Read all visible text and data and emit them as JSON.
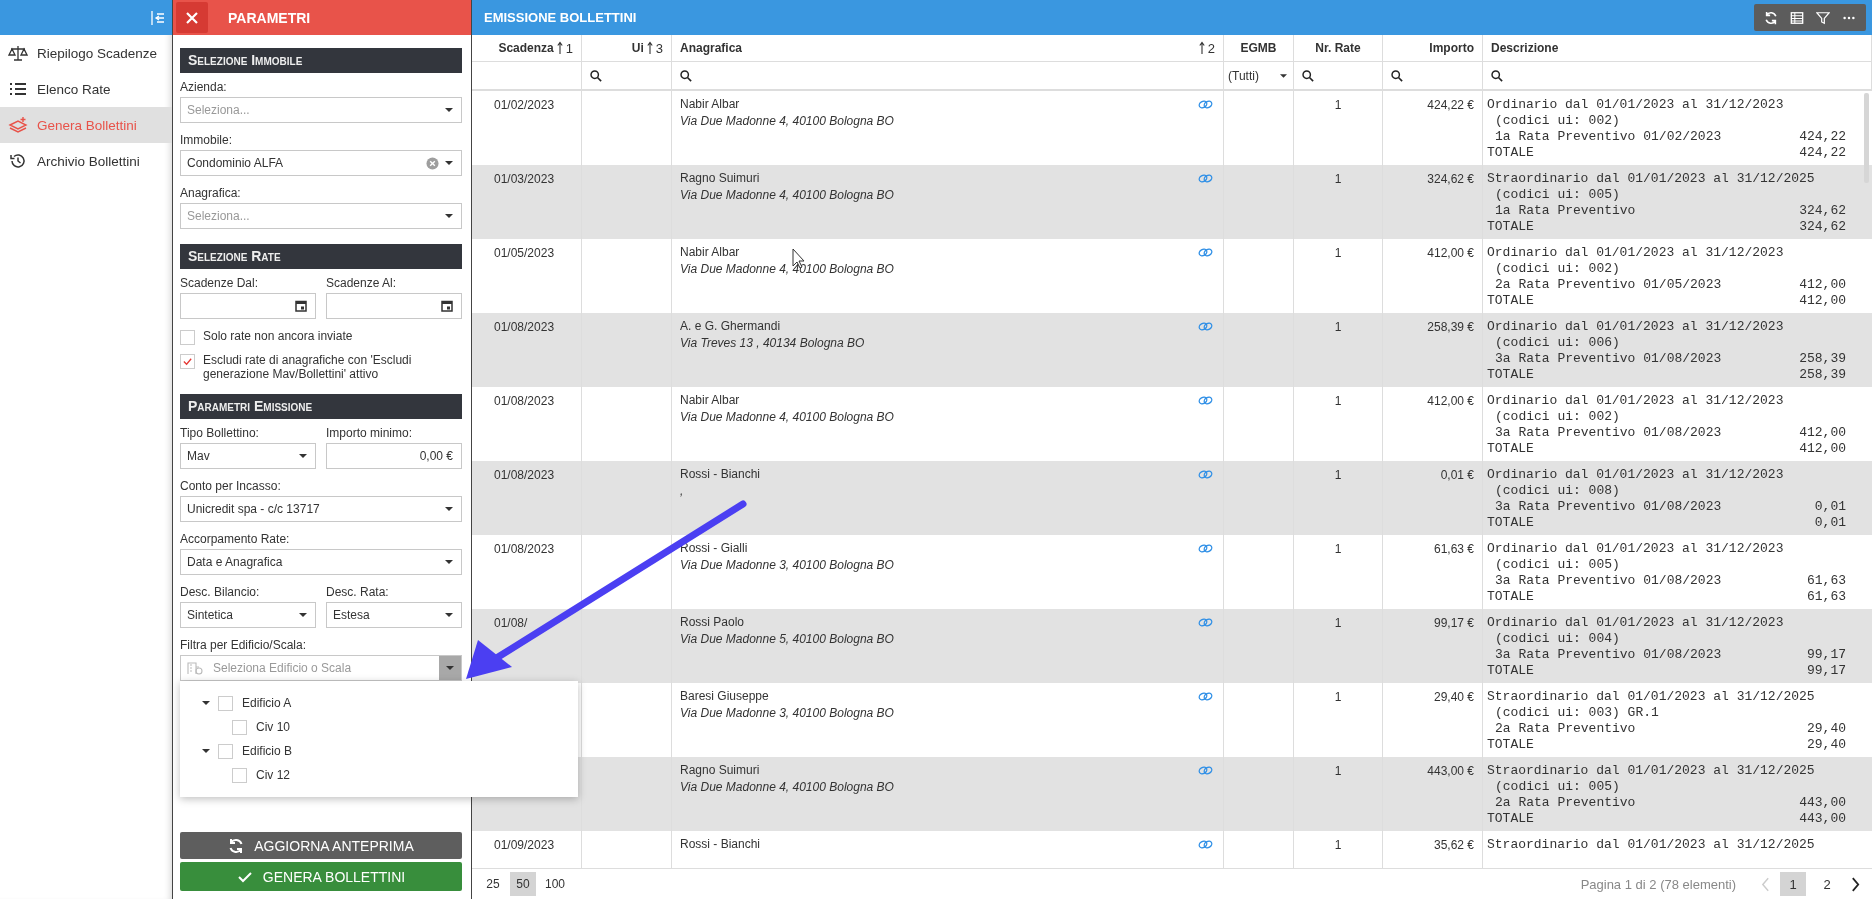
{
  "sidebar": {
    "items": [
      {
        "label": "Riepilogo Scadenze",
        "selected": false
      },
      {
        "label": "Elenco Rate",
        "selected": false
      },
      {
        "label": "Genera Bollettini",
        "selected": true
      },
      {
        "label": "Archivio Bollettini",
        "selected": false
      }
    ]
  },
  "params": {
    "title": "PARAMETRI",
    "sections": [
      {
        "title": "Selezione Immobile",
        "rows": [
          [
            {
              "kind": "select",
              "label": "Azienda:",
              "placeholder": "Seleziona..."
            }
          ],
          [
            {
              "kind": "select",
              "label": "Immobile:",
              "value": "Condominio ALFA",
              "clearable": true
            }
          ],
          [
            {
              "kind": "select",
              "label": "Anagrafica:",
              "placeholder": "Seleziona..."
            }
          ]
        ]
      },
      {
        "title": "Selezione Rate",
        "rows": [
          [
            {
              "kind": "date",
              "label": "Scadenze Dal:"
            },
            {
              "kind": "date",
              "label": "Scadenze Al:"
            }
          ],
          [
            {
              "kind": "checkbox",
              "label": "Solo rate non ancora inviate",
              "checked": false
            }
          ],
          [
            {
              "kind": "checkbox",
              "label": "Escludi rate di anagrafiche con 'Escludi generazione Mav/Bollettini' attivo",
              "checked": true
            }
          ]
        ]
      },
      {
        "title": "Parametri Emissione",
        "rows": [
          [
            {
              "kind": "select",
              "label": "Tipo Bollettino:",
              "value": "Mav"
            },
            {
              "kind": "input",
              "label": "Importo minimo:",
              "value": "0,00 €"
            }
          ],
          [
            {
              "kind": "select",
              "label": "Conto per Incasso:",
              "value": "Unicredit spa - c/c 13717"
            }
          ],
          [
            {
              "kind": "select",
              "label": "Accorpamento Rate:",
              "value": "Data e Anagrafica"
            }
          ],
          [
            {
              "kind": "select",
              "label": "Desc. Bilancio:",
              "value": "Sintetica"
            },
            {
              "kind": "select",
              "label": "Desc. Rata:",
              "value": "Estesa"
            }
          ],
          [
            {
              "kind": "tree",
              "label": "Filtra per Edificio/Scala:",
              "placeholder": "Seleziona Edificio o Scala",
              "expanded": true,
              "options": [
                {
                  "label": "Edificio A",
                  "checked": false,
                  "expanded": true,
                  "children": [
                    {
                      "label": "Civ 10",
                      "checked": false
                    }
                  ]
                },
                {
                  "label": "Edificio B",
                  "checked": false,
                  "expanded": true,
                  "children": [
                    {
                      "label": "Civ 12",
                      "checked": false
                    }
                  ]
                }
              ]
            }
          ]
        ]
      }
    ],
    "buttons": [
      {
        "label": "AGGIORNA ANTEPRIMA",
        "kind": "refresh"
      },
      {
        "label": "GENERA BOLLETTINI",
        "kind": "confirm"
      }
    ]
  },
  "main": {
    "title": "EMISSIONE BOLLETTINI",
    "table": {
      "columns": [
        {
          "label": "Scadenza",
          "sort_index": "1"
        },
        {
          "label": "Ui",
          "sort_index": "3",
          "filter": {
            "kind": "search"
          }
        },
        {
          "label": "Anagrafica",
          "sort_index": "2",
          "filter": {
            "kind": "search"
          }
        },
        {
          "label": "EGMB",
          "filter": {
            "kind": "select",
            "value": "(Tutti)"
          }
        },
        {
          "label": "Nr. Rate",
          "filter": {
            "kind": "search"
          }
        },
        {
          "label": "Importo",
          "filter": {
            "kind": "search"
          }
        },
        {
          "label": "Descrizione",
          "filter": {
            "kind": "search"
          }
        }
      ],
      "rows": [
        {
          "scadenza": "01/02/2023",
          "name": "Nabir Albar",
          "address": "Via Due Madonne 4, 40100 Bologna BO",
          "rate": "1",
          "importo": "424,22 €",
          "description": [
            {
              "text": "Ordinario dal 01/01/2023 al 31/12/2023",
              "indent": false
            },
            {
              "text": "(codici ui: 002)",
              "indent": true
            },
            {
              "text": "1a Rata Preventivo 01/02/2023",
              "amount": "424,22",
              "indent": true
            },
            {
              "text": "TOTALE",
              "amount": "424,22",
              "indent": false
            }
          ]
        },
        {
          "scadenza": "01/03/2023",
          "name": "Ragno Suimuri",
          "address": "Via Due Madonne 4, 40100 Bologna BO",
          "rate": "1",
          "importo": "324,62 €",
          "description": [
            {
              "text": "Straordinario dal 01/01/2023 al 31/12/2025",
              "indent": false
            },
            {
              "text": "(codici ui: 005)",
              "indent": true
            },
            {
              "text": "1a Rata Preventivo",
              "amount": "324,62",
              "indent": true
            },
            {
              "text": "TOTALE",
              "amount": "324,62",
              "indent": false
            }
          ]
        },
        {
          "scadenza": "01/05/2023",
          "name": "Nabir Albar",
          "address": "Via Due Madonne 4, 40100 Bologna BO",
          "rate": "1",
          "importo": "412,00 €",
          "description": [
            {
              "text": "Ordinario dal 01/01/2023 al 31/12/2023",
              "indent": false
            },
            {
              "text": "(codici ui: 002)",
              "indent": true
            },
            {
              "text": "2a Rata Preventivo 01/05/2023",
              "amount": "412,00",
              "indent": true
            },
            {
              "text": "TOTALE",
              "amount": "412,00",
              "indent": false
            }
          ]
        },
        {
          "scadenza": "01/08/2023",
          "name": "A. e G. Ghermandi",
          "address": "Via Treves 13 , 40134 Bologna BO",
          "rate": "1",
          "importo": "258,39 €",
          "description": [
            {
              "text": "Ordinario dal 01/01/2023 al 31/12/2023",
              "indent": false
            },
            {
              "text": "(codici ui: 006)",
              "indent": true
            },
            {
              "text": "3a Rata Preventivo 01/08/2023",
              "amount": "258,39",
              "indent": true
            },
            {
              "text": "TOTALE",
              "amount": "258,39",
              "indent": false
            }
          ]
        },
        {
          "scadenza": "01/08/2023",
          "name": "Nabir Albar",
          "address": "Via Due Madonne 4, 40100 Bologna BO",
          "rate": "1",
          "importo": "412,00 €",
          "description": [
            {
              "text": "Ordinario dal 01/01/2023 al 31/12/2023",
              "indent": false
            },
            {
              "text": "(codici ui: 002)",
              "indent": true
            },
            {
              "text": "3a Rata Preventivo 01/08/2023",
              "amount": "412,00",
              "indent": true
            },
            {
              "text": "TOTALE",
              "amount": "412,00",
              "indent": false
            }
          ]
        },
        {
          "scadenza": "01/08/2023",
          "name": "Rossi - Bianchi",
          "address": ",",
          "rate": "1",
          "importo": "0,01 €",
          "description": [
            {
              "text": "Ordinario dal 01/01/2023 al 31/12/2023",
              "indent": false
            },
            {
              "text": "(codici ui: 008)",
              "indent": true
            },
            {
              "text": "3a Rata Preventivo 01/08/2023",
              "amount": "0,01",
              "indent": true
            },
            {
              "text": "TOTALE",
              "amount": "0,01",
              "indent": false
            }
          ]
        },
        {
          "scadenza": "01/08/2023",
          "name": "Rossi - Gialli",
          "address": "Via Due Madonne 3, 40100 Bologna BO",
          "rate": "1",
          "importo": "61,63 €",
          "description": [
            {
              "text": "Ordinario dal 01/01/2023 al 31/12/2023",
              "indent": false
            },
            {
              "text": "(codici ui: 005)",
              "indent": true
            },
            {
              "text": "3a Rata Preventivo 01/08/2023",
              "amount": "61,63",
              "indent": true
            },
            {
              "text": "TOTALE",
              "amount": "61,63",
              "indent": false
            }
          ]
        },
        {
          "scadenza": "01/08/",
          "name": "Rossi Paolo",
          "address": "Via Due Madonne 5, 40100 Bologna BO",
          "rate": "1",
          "importo": "99,17 €",
          "description": [
            {
              "text": "Ordinario dal 01/01/2023 al 31/12/2023",
              "indent": false
            },
            {
              "text": "(codici ui: 004)",
              "indent": true
            },
            {
              "text": "3a Rata Preventivo 01/08/2023",
              "amount": "99,17",
              "indent": true
            },
            {
              "text": "TOTALE",
              "amount": "99,17",
              "indent": false
            }
          ]
        },
        {
          "name": "Baresi Giuseppe",
          "address": "Via Due Madonne 3, 40100 Bologna BO",
          "rate": "1",
          "importo": "29,40 €",
          "description": [
            {
              "text": "Straordinario dal 01/01/2023 al 31/12/2025",
              "indent": false
            },
            {
              "text": "(codici ui: 003) GR.1",
              "indent": true
            },
            {
              "text": "2a Rata Preventivo",
              "amount": "29,40",
              "indent": true
            },
            {
              "text": "TOTALE",
              "amount": "29,40",
              "indent": false
            }
          ]
        },
        {
          "name": "Ragno Suimuri",
          "address": "Via Due Madonne 4, 40100 Bologna BO",
          "rate": "1",
          "importo": "443,00 €",
          "description": [
            {
              "text": "Straordinario dal 01/01/2023 al 31/12/2025",
              "indent": false
            },
            {
              "text": "(codici ui: 005)",
              "indent": true
            },
            {
              "text": "2a Rata Preventivo",
              "amount": "443,00",
              "indent": true
            },
            {
              "text": "TOTALE",
              "amount": "443,00",
              "indent": false
            }
          ]
        },
        {
          "scadenza": "01/09/2023",
          "name": "Rossi - Bianchi",
          "rate": "1",
          "importo": "35,62 €",
          "description": [
            {
              "text": "Straordinario dal 01/01/2023 al 31/12/2025",
              "indent": false
            }
          ]
        }
      ]
    },
    "pager": {
      "page_sizes": [
        {
          "label": "25",
          "selected": false
        },
        {
          "label": "50",
          "selected": true
        },
        {
          "label": "100",
          "selected": false
        }
      ],
      "summary": "Pagina 1 di 2 (78 elementi)",
      "prev_disabled": true,
      "pages": [
        {
          "label": "1",
          "selected": true
        },
        {
          "label": "2",
          "selected": false
        }
      ]
    }
  }
}
